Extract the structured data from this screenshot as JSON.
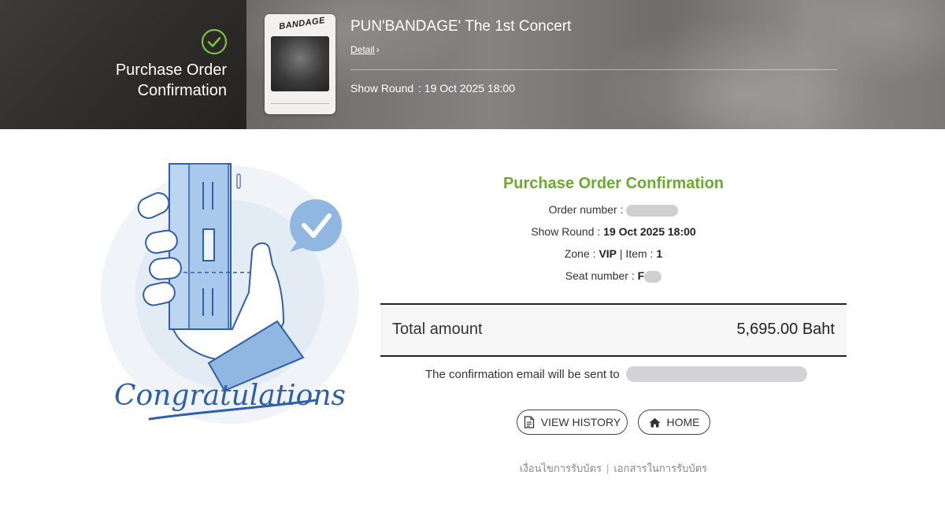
{
  "header": {
    "page_title_line1": "Purchase Order",
    "page_title_line2": "Confirmation",
    "poster_logo": "BANDAGE",
    "event_title": "PUN'BANDAGE' The 1st Concert",
    "detail_link": "Detail",
    "show_round_label": "Show Round",
    "show_round_value": ": 19 Oct 2025 18:00"
  },
  "illustration": {
    "caption": "Congratulations"
  },
  "order": {
    "title": "Purchase Order Confirmation",
    "order_number_label": "Order number :",
    "show_round_label": "Show Round :",
    "show_round_value": "19 Oct 2025 18:00",
    "zone_label": "Zone :",
    "zone_value": "VIP",
    "item_label": "| Item :",
    "item_value": "1",
    "seat_label": "Seat number :",
    "seat_value_prefix": "F",
    "total_label": "Total amount",
    "total_value": "5,695.00 Baht",
    "email_text": "The confirmation email will be sent to"
  },
  "buttons": {
    "view_history": "VIEW HISTORY",
    "home": "HOME"
  },
  "footer": {
    "link1": "เงื่อนไขการรับบัตร",
    "separator": "|",
    "link2": "เอกสารในการรับบัตร"
  },
  "colors": {
    "accent_green": "#6aaa2e",
    "illustration_blue": "#2f5fa8",
    "illustration_light_blue": "#9cc4ea"
  }
}
